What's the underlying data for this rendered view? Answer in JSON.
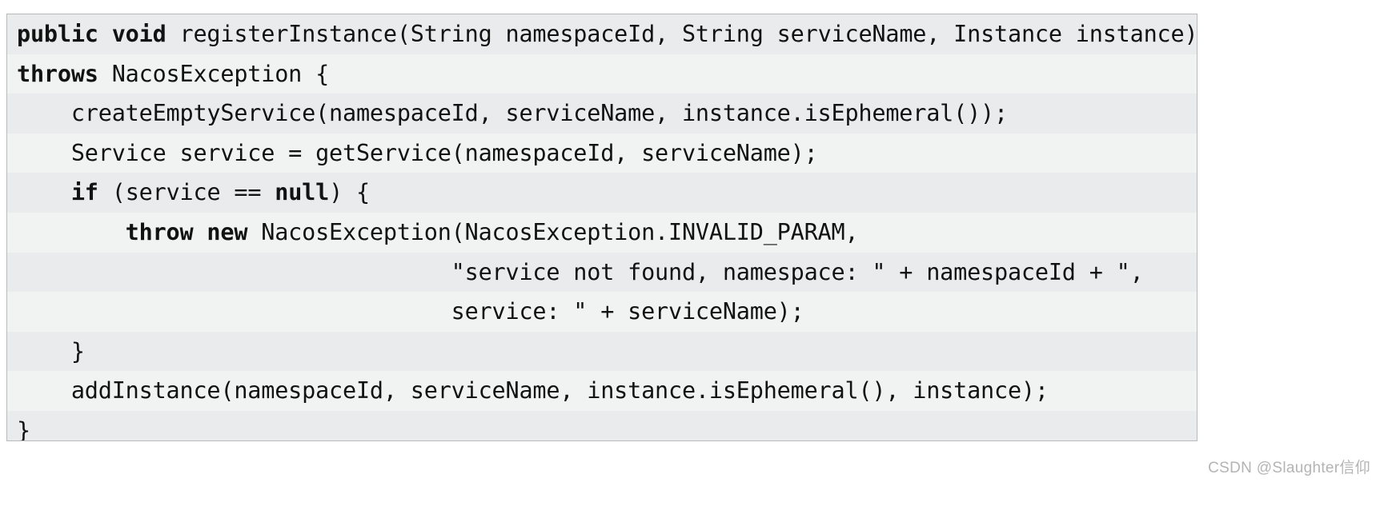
{
  "figure": {
    "language": "java",
    "border_color": "#b9b9b9",
    "background_color": "#eceded",
    "stripe_colors": [
      "#eaebec",
      "#f1f2f2"
    ],
    "text_color": "#121212"
  },
  "code": {
    "lines": [
      {
        "index": 1,
        "indent": 0,
        "segments": [
          {
            "text": "public void ",
            "bold": true
          },
          {
            "text": "registerInstance(String namespaceId, String serviceName, Instance instance)",
            "bold": false
          }
        ],
        "plain": "public void registerInstance(String namespaceId, String serviceName, Instance instance)"
      },
      {
        "index": 2,
        "indent": 0,
        "segments": [
          {
            "text": "throws ",
            "bold": true
          },
          {
            "text": "NacosException {",
            "bold": false
          }
        ],
        "plain": "throws NacosException {"
      },
      {
        "index": 3,
        "indent": 1,
        "segments": [
          {
            "text": "createEmptyService(namespaceId, serviceName, instance.isEphemeral());",
            "bold": false
          }
        ],
        "plain": "    createEmptyService(namespaceId, serviceName, instance.isEphemeral());"
      },
      {
        "index": 4,
        "indent": 1,
        "segments": [
          {
            "text": "Service service = getService(namespaceId, serviceName);",
            "bold": false
          }
        ],
        "plain": "    Service service = getService(namespaceId, serviceName);"
      },
      {
        "index": 5,
        "indent": 1,
        "segments": [
          {
            "text": "if ",
            "bold": true
          },
          {
            "text": "(service == ",
            "bold": false
          },
          {
            "text": "null",
            "bold": true
          },
          {
            "text": ") {",
            "bold": false
          }
        ],
        "plain": "    if (service == null) {"
      },
      {
        "index": 6,
        "indent": 2,
        "segments": [
          {
            "text": "throw new ",
            "bold": true
          },
          {
            "text": "NacosException(NacosException.INVALID_PARAM,",
            "bold": false
          }
        ],
        "plain": "        throw new NacosException(NacosException.INVALID_PARAM,"
      },
      {
        "index": 7,
        "indent": 0,
        "segments": [
          {
            "text": "                                \"service not found, namespace: \" + namespaceId + \",",
            "bold": false
          }
        ],
        "plain": "                                \"service not found, namespace: \" + namespaceId + \","
      },
      {
        "index": 8,
        "indent": 0,
        "segments": [
          {
            "text": "                                service: \" + serviceName);",
            "bold": false
          }
        ],
        "plain": "                                service: \" + serviceName);"
      },
      {
        "index": 9,
        "indent": 1,
        "segments": [
          {
            "text": "}",
            "bold": false
          }
        ],
        "plain": "    }"
      },
      {
        "index": 10,
        "indent": 1,
        "segments": [
          {
            "text": "addInstance(namespaceId, serviceName, instance.isEphemeral(), instance);",
            "bold": false
          }
        ],
        "plain": "    addInstance(namespaceId, serviceName, instance.isEphemeral(), instance);"
      },
      {
        "index": 11,
        "indent": 0,
        "segments": [
          {
            "text": "}",
            "bold": false
          }
        ],
        "plain": "}"
      }
    ]
  },
  "watermark": {
    "text": "CSDN @Slaughter信仰",
    "color": "#b4b4b4"
  }
}
